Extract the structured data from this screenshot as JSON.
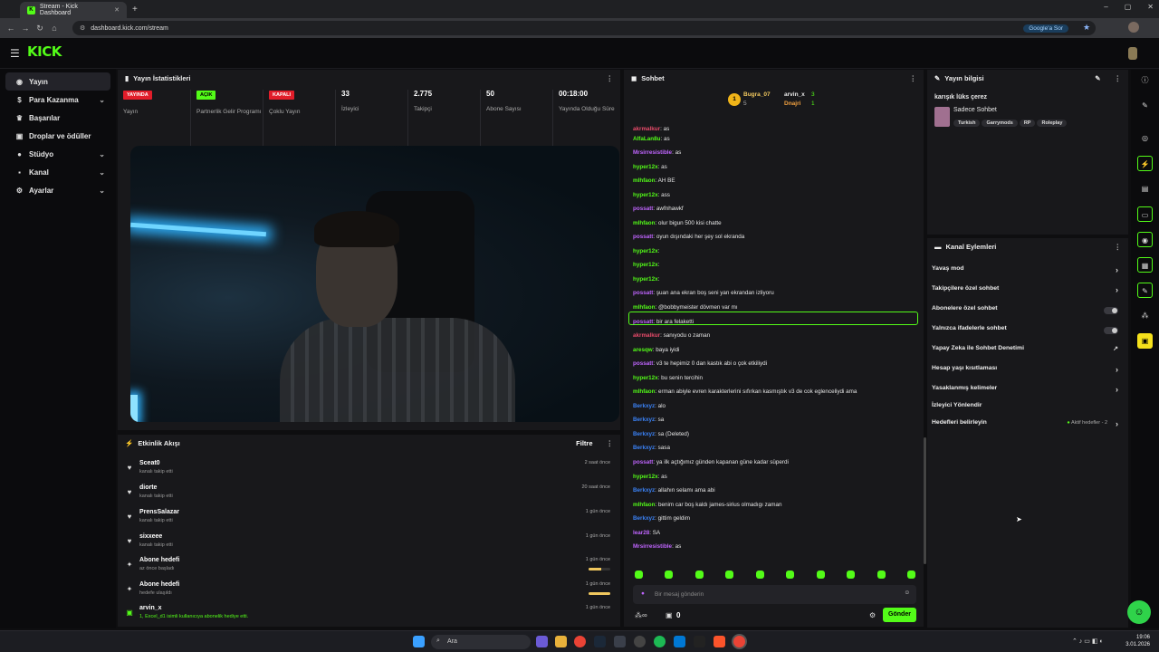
{
  "browser": {
    "tab_title": "Stream - Kick Dashboard",
    "url": "dashboard.kick.com/stream",
    "google_btn": "Google'a Sor"
  },
  "brand": {
    "logo": "KICK",
    "accent": "#53fc18"
  },
  "sidebar": {
    "items": [
      {
        "label": "Yayın",
        "icon": "broadcast-icon",
        "active": true,
        "chevron": false
      },
      {
        "label": "Para Kazanma",
        "icon": "money-icon",
        "chevron": true
      },
      {
        "label": "Başarılar",
        "icon": "trophy-icon",
        "chevron": false
      },
      {
        "label": "Droplar ve ödüller",
        "icon": "gift-icon",
        "chevron": false
      },
      {
        "label": "Stüdyo",
        "icon": "studio-icon",
        "chevron": true
      },
      {
        "label": "Kanal",
        "icon": "channel-icon",
        "chevron": true
      },
      {
        "label": "Ayarlar",
        "icon": "gear-icon",
        "chevron": true
      }
    ]
  },
  "stats": {
    "title": "Yayın İstatistikleri",
    "items": [
      {
        "badge": "YAYINDA",
        "badge_color": "#e11d2a",
        "label": "Yayın"
      },
      {
        "badge": "AÇIK",
        "badge_color": "#53fc18",
        "label": "Partnerlik Gelir Programı"
      },
      {
        "badge": "KAPALI",
        "badge_color": "#e11d2a",
        "label": "Çoklu Yayın"
      },
      {
        "value": "33",
        "label": "İzleyici"
      },
      {
        "value": "2.775",
        "label": "Takipçi"
      },
      {
        "value": "50",
        "label": "Abone Sayısı"
      },
      {
        "value": "00:18:00",
        "label": "Yayında Olduğu Süre"
      }
    ]
  },
  "events": {
    "title": "Etkinlik Akışı",
    "filter": "Filtre",
    "items": [
      {
        "icon": "heart-icon",
        "name": "Sceat0",
        "sub": "kanalı takip etti",
        "time": "2 saat önce"
      },
      {
        "icon": "heart-icon",
        "name": "diorte",
        "sub": "kanalı takip etti",
        "time": "20 saat önce"
      },
      {
        "icon": "heart-icon",
        "name": "PrensSalazar",
        "sub": "kanalı takip etti",
        "time": "1 gün önce"
      },
      {
        "icon": "heart-icon",
        "name": "sixxeee",
        "sub": "kanalı takip etti",
        "time": "1 gün önce"
      },
      {
        "icon": "sparkle-icon",
        "name": "Abone hedefi",
        "sub": "az önce başladı",
        "time": "1 gün önce",
        "progress": 0.6
      },
      {
        "icon": "sparkle-icon",
        "name": "Abone hedefi",
        "sub": "hedefe ulaşıldı",
        "time": "1 gün önce",
        "progress": 1.0
      },
      {
        "icon": "gift-icon",
        "name": "arvin_x",
        "sub": "1, Excel_d1 isimli kullanıcıya abonelik hediye etti.",
        "time": "1 gün önce"
      }
    ]
  },
  "chat": {
    "title": "Sohbet",
    "top1": {
      "name": "Bugra_07",
      "count": "5"
    },
    "top2": {
      "name": "arvin_x",
      "count": "3"
    },
    "top3": {
      "name": "Dnajri",
      "count": "1"
    },
    "messages": [
      {
        "user": "akrmalkur",
        "color": "#e84b6a",
        "text": "as"
      },
      {
        "user": "AlfaLan8u",
        "color": "#53fc18",
        "text": "as"
      },
      {
        "user": "Mrsirresistible",
        "color": "#c065ff",
        "text": "as"
      },
      {
        "user": "hyper12x",
        "color": "#53fc18",
        "text": "as"
      },
      {
        "user": "mlhfaon",
        "color": "#53fc18",
        "text": "AH BE"
      },
      {
        "user": "hyper12x",
        "color": "#53fc18",
        "text": "ass"
      },
      {
        "user": "possatt",
        "color": "#c065ff",
        "text": "awfnhawkf"
      },
      {
        "user": "mlhfaon",
        "color": "#53fc18",
        "text": "olur bigun 500 kisi chatte"
      },
      {
        "user": "possatt",
        "color": "#c065ff",
        "text": "oyun dışındaki her şey sol ekranda"
      },
      {
        "user": "hyper12x",
        "color": "#53fc18",
        "text": ""
      },
      {
        "user": "hyper12x",
        "color": "#53fc18",
        "text": ""
      },
      {
        "user": "hyper12x",
        "color": "#53fc18",
        "text": ""
      },
      {
        "user": "possatt",
        "color": "#c065ff",
        "text": "şuan ana ekran boş seni yan ekrandan izliyoru"
      },
      {
        "user": "mlhfaon",
        "color": "#53fc18",
        "text": "@bobbymeister dövmen var mı"
      },
      {
        "user": "possatt",
        "color": "#c065ff",
        "text": "bir ara felaketti"
      },
      {
        "user": "akrmalkur",
        "color": "#e84b6a",
        "text": "sanıyodu o zaman"
      },
      {
        "user": "aresqw",
        "color": "#53fc18",
        "text": "baya iyidi"
      },
      {
        "user": "possatt",
        "color": "#c065ff",
        "text": "v3 te hepimiz 0 dan kastık abi o çok etkiliydi"
      },
      {
        "user": "hyper12x",
        "color": "#53fc18",
        "text": "bu senin tercihin"
      },
      {
        "user": "mlhfaon",
        "color": "#53fc18",
        "text": "erman abiyle evren karakterlerini sıfırkan kasmıştık v3 de cok eglenceliydi ama"
      },
      {
        "user": "Berkxyz",
        "color": "#3b82f6",
        "text": "alo"
      },
      {
        "user": "Berkxyz",
        "color": "#3b82f6",
        "text": "sa"
      },
      {
        "user": "Berkxyz",
        "color": "#3b82f6",
        "text": "sa (Deleted)"
      },
      {
        "user": "Berkxyz",
        "color": "#3b82f6",
        "text": "sasa"
      },
      {
        "user": "possatt",
        "color": "#c065ff",
        "text": "ya ilk açtığımız günden kapanan güne kadar süperdi"
      },
      {
        "user": "hyper12x",
        "color": "#53fc18",
        "text": "as"
      },
      {
        "user": "Berkxyz",
        "color": "#3b82f6",
        "text": "allahın selamı ama abi"
      },
      {
        "user": "mlhfaon",
        "color": "#53fc18",
        "text": "benim car boş kaldı james-sirius olmadıgı zaman"
      },
      {
        "user": "Berkxyz",
        "color": "#3b82f6",
        "text": "gittim geldim"
      },
      {
        "user": "lear28",
        "color": "#c065ff",
        "text": "SA"
      },
      {
        "user": "Mrsirresistible",
        "color": "#c065ff",
        "text": "as"
      }
    ],
    "input_placeholder": "Bir mesaj gönderin",
    "send": "Gönder",
    "kick_count": "0"
  },
  "info": {
    "title": "Yayın bilgisi",
    "stream_title": "karışık lüks çerez",
    "category": "Sadece Sohbet",
    "tags": [
      "Turkish",
      "Garrymods",
      "RP",
      "Roleplay"
    ]
  },
  "actions": {
    "title": "Kanal Eylemleri",
    "items": [
      {
        "label": "Yavaş mod",
        "kind": "chevron"
      },
      {
        "label": "Takipçilere özel sohbet",
        "kind": "chevron"
      },
      {
        "label": "Abonelere özel sohbet",
        "kind": "toggle"
      },
      {
        "label": "Yalnızca ifadelerle sohbet",
        "kind": "toggle"
      },
      {
        "label": "Yapay Zeka ile Sohbet Denetimi",
        "kind": "external"
      },
      {
        "label": "Hesap yaşı kısıtlaması",
        "kind": "chevron"
      },
      {
        "label": "Yasaklanmış kelimeler",
        "kind": "chevron"
      },
      {
        "label": "İzleyici Yönlendir",
        "kind": "none"
      },
      {
        "label": "Hedefleri belirleyin",
        "kind": "chevron",
        "note": "Aktif hedefler - 2"
      }
    ]
  },
  "taskbar": {
    "search": "Ara",
    "time": "19:06",
    "date": "3.01.2026"
  }
}
